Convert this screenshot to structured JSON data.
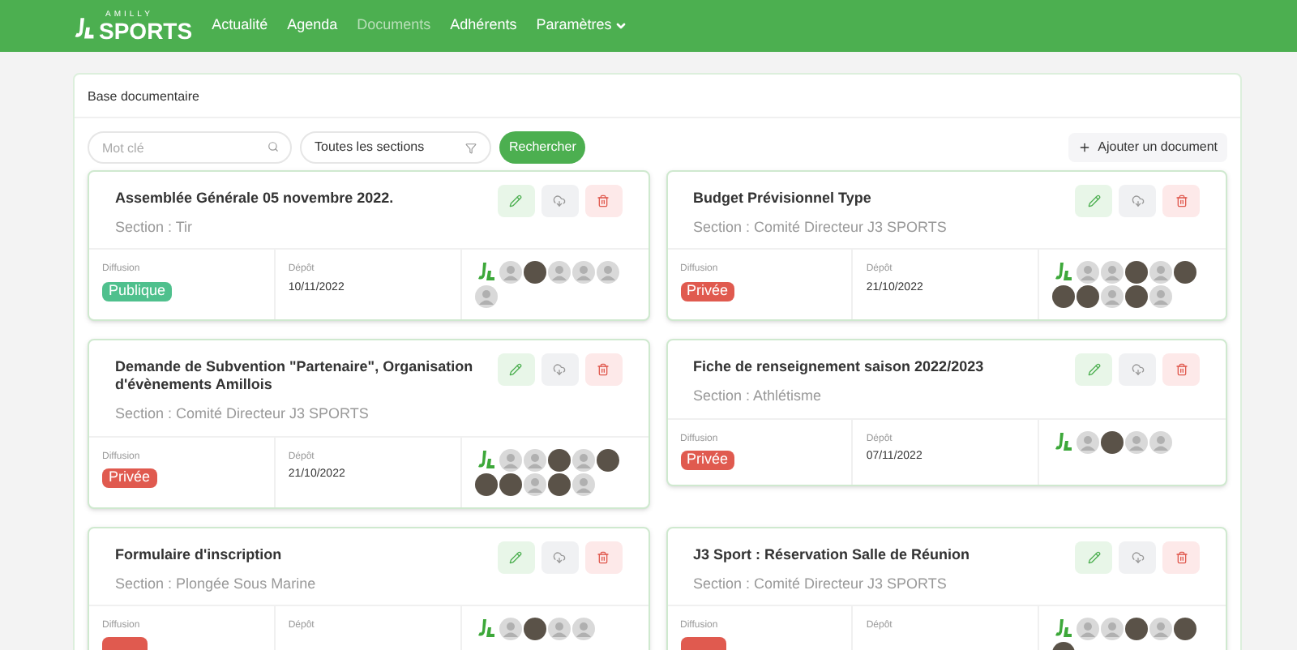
{
  "nav": {
    "logo_small": "AMILLY",
    "logo": "SPORTS",
    "items": [
      {
        "label": "Actualité",
        "selected": false,
        "dropdown": false
      },
      {
        "label": "Agenda",
        "selected": false,
        "dropdown": false
      },
      {
        "label": "Documents",
        "selected": true,
        "dropdown": false
      },
      {
        "label": "Adhérents",
        "selected": false,
        "dropdown": false
      },
      {
        "label": "Paramètres",
        "selected": false,
        "dropdown": true
      }
    ]
  },
  "panel": {
    "title": "Base documentaire"
  },
  "toolbar": {
    "search": {
      "placeholder": "Mot clé"
    },
    "section_select": {
      "value": "Toutes les sections"
    },
    "search_button": "Rechercher",
    "add_button": "Ajouter un document"
  },
  "documents": [
    {
      "title": "Assemblée Générale 05 novembre 2022.",
      "section": "Section : Tir",
      "diffusion_label": "Diffusion",
      "visibility": {
        "kind": "public",
        "label": "Publique"
      },
      "date_label": "Dépôt",
      "date": "10/11/2022",
      "avatars": [
        {
          "kind": "logo"
        },
        {
          "kind": "default"
        },
        {
          "kind": "photo"
        },
        {
          "kind": "default"
        },
        {
          "kind": "default"
        },
        {
          "kind": "default"
        },
        {
          "kind": "default"
        }
      ]
    },
    {
      "title": "Budget Prévisionnel Type",
      "section": "Section : Comité Directeur J3 SPORTS",
      "diffusion_label": "Diffusion",
      "visibility": {
        "kind": "private",
        "label": "Privée"
      },
      "date_label": "Dépôt",
      "date": "21/10/2022",
      "avatars": [
        {
          "kind": "logo"
        },
        {
          "kind": "default"
        },
        {
          "kind": "default"
        },
        {
          "kind": "photo"
        },
        {
          "kind": "default"
        },
        {
          "kind": "photo"
        },
        {
          "kind": "photo"
        },
        {
          "kind": "photo"
        },
        {
          "kind": "default"
        },
        {
          "kind": "photo"
        },
        {
          "kind": "default"
        }
      ]
    },
    {
      "title": "Demande de Subvention \"Partenaire\", Organisation d'évènements Amillois",
      "section": "Section : Comité Directeur J3 SPORTS",
      "diffusion_label": "Diffusion",
      "visibility": {
        "kind": "private",
        "label": "Privée"
      },
      "date_label": "Dépôt",
      "date": "21/10/2022",
      "avatars": [
        {
          "kind": "logo"
        },
        {
          "kind": "default"
        },
        {
          "kind": "default"
        },
        {
          "kind": "photo"
        },
        {
          "kind": "default"
        },
        {
          "kind": "photo"
        },
        {
          "kind": "photo"
        },
        {
          "kind": "photo"
        },
        {
          "kind": "default"
        },
        {
          "kind": "photo"
        },
        {
          "kind": "default"
        }
      ]
    },
    {
      "title": "Fiche de renseignement saison 2022/2023",
      "section": "Section : Athlétisme",
      "diffusion_label": "Diffusion",
      "visibility": {
        "kind": "private",
        "label": "Privée"
      },
      "date_label": "Dépôt",
      "date": "07/11/2022",
      "avatars": [
        {
          "kind": "logo"
        },
        {
          "kind": "default"
        },
        {
          "kind": "photo"
        },
        {
          "kind": "default"
        },
        {
          "kind": "default"
        }
      ]
    },
    {
      "title": "Formulaire d'inscription",
      "section": "Section : Plongée Sous Marine",
      "diffusion_label": "Diffusion",
      "visibility": {
        "kind": "private"
      },
      "date_label": "Dépôt",
      "avatars": [
        {
          "kind": "logo"
        },
        {
          "kind": "default"
        },
        {
          "kind": "photo"
        },
        {
          "kind": "default"
        },
        {
          "kind": "default"
        }
      ]
    },
    {
      "title": "J3 Sport : Réservation Salle de Réunion",
      "section": "Section : Comité Directeur J3 SPORTS",
      "diffusion_label": "Diffusion",
      "visibility": {
        "kind": "private"
      },
      "date_label": "Dépôt",
      "avatars": [
        {
          "kind": "logo"
        },
        {
          "kind": "default"
        },
        {
          "kind": "default"
        },
        {
          "kind": "photo"
        },
        {
          "kind": "default"
        },
        {
          "kind": "photo"
        },
        {
          "kind": "photo"
        }
      ]
    }
  ]
}
